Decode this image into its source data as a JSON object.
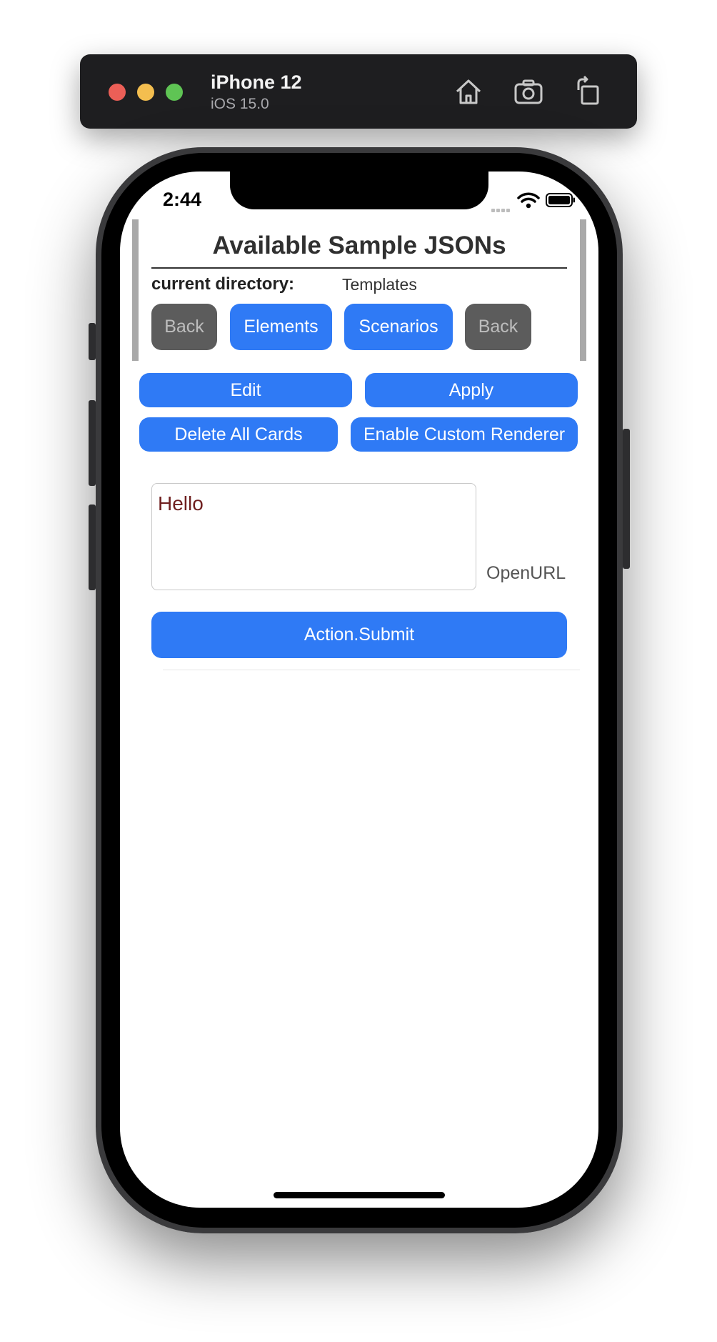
{
  "simulator": {
    "device_name": "iPhone 12",
    "os_version": "iOS 15.0",
    "icons": [
      "home-icon",
      "screenshot-icon",
      "rotate-icon"
    ]
  },
  "status_bar": {
    "time": "2:44",
    "icons": [
      "cellular-icon",
      "wifi-icon",
      "battery-icon"
    ]
  },
  "header": {
    "title": "Available Sample JSONs",
    "directory_label": "current directory:",
    "directory_value": "Templates"
  },
  "nav_buttons": {
    "back_left": "Back",
    "elements": "Elements",
    "scenarios": "Scenarios",
    "back_right": "Back"
  },
  "actions": {
    "edit": "Edit",
    "apply": "Apply",
    "delete_all": "Delete All Cards",
    "enable_renderer": "Enable Custom Renderer"
  },
  "card": {
    "input_value": "Hello",
    "open_url_label": "OpenURL",
    "submit_label": "Action.Submit"
  },
  "colors": {
    "accent_blue": "#2f7af5",
    "disabled_gray": "#5c5c5c",
    "input_text": "#6f1f1f"
  }
}
